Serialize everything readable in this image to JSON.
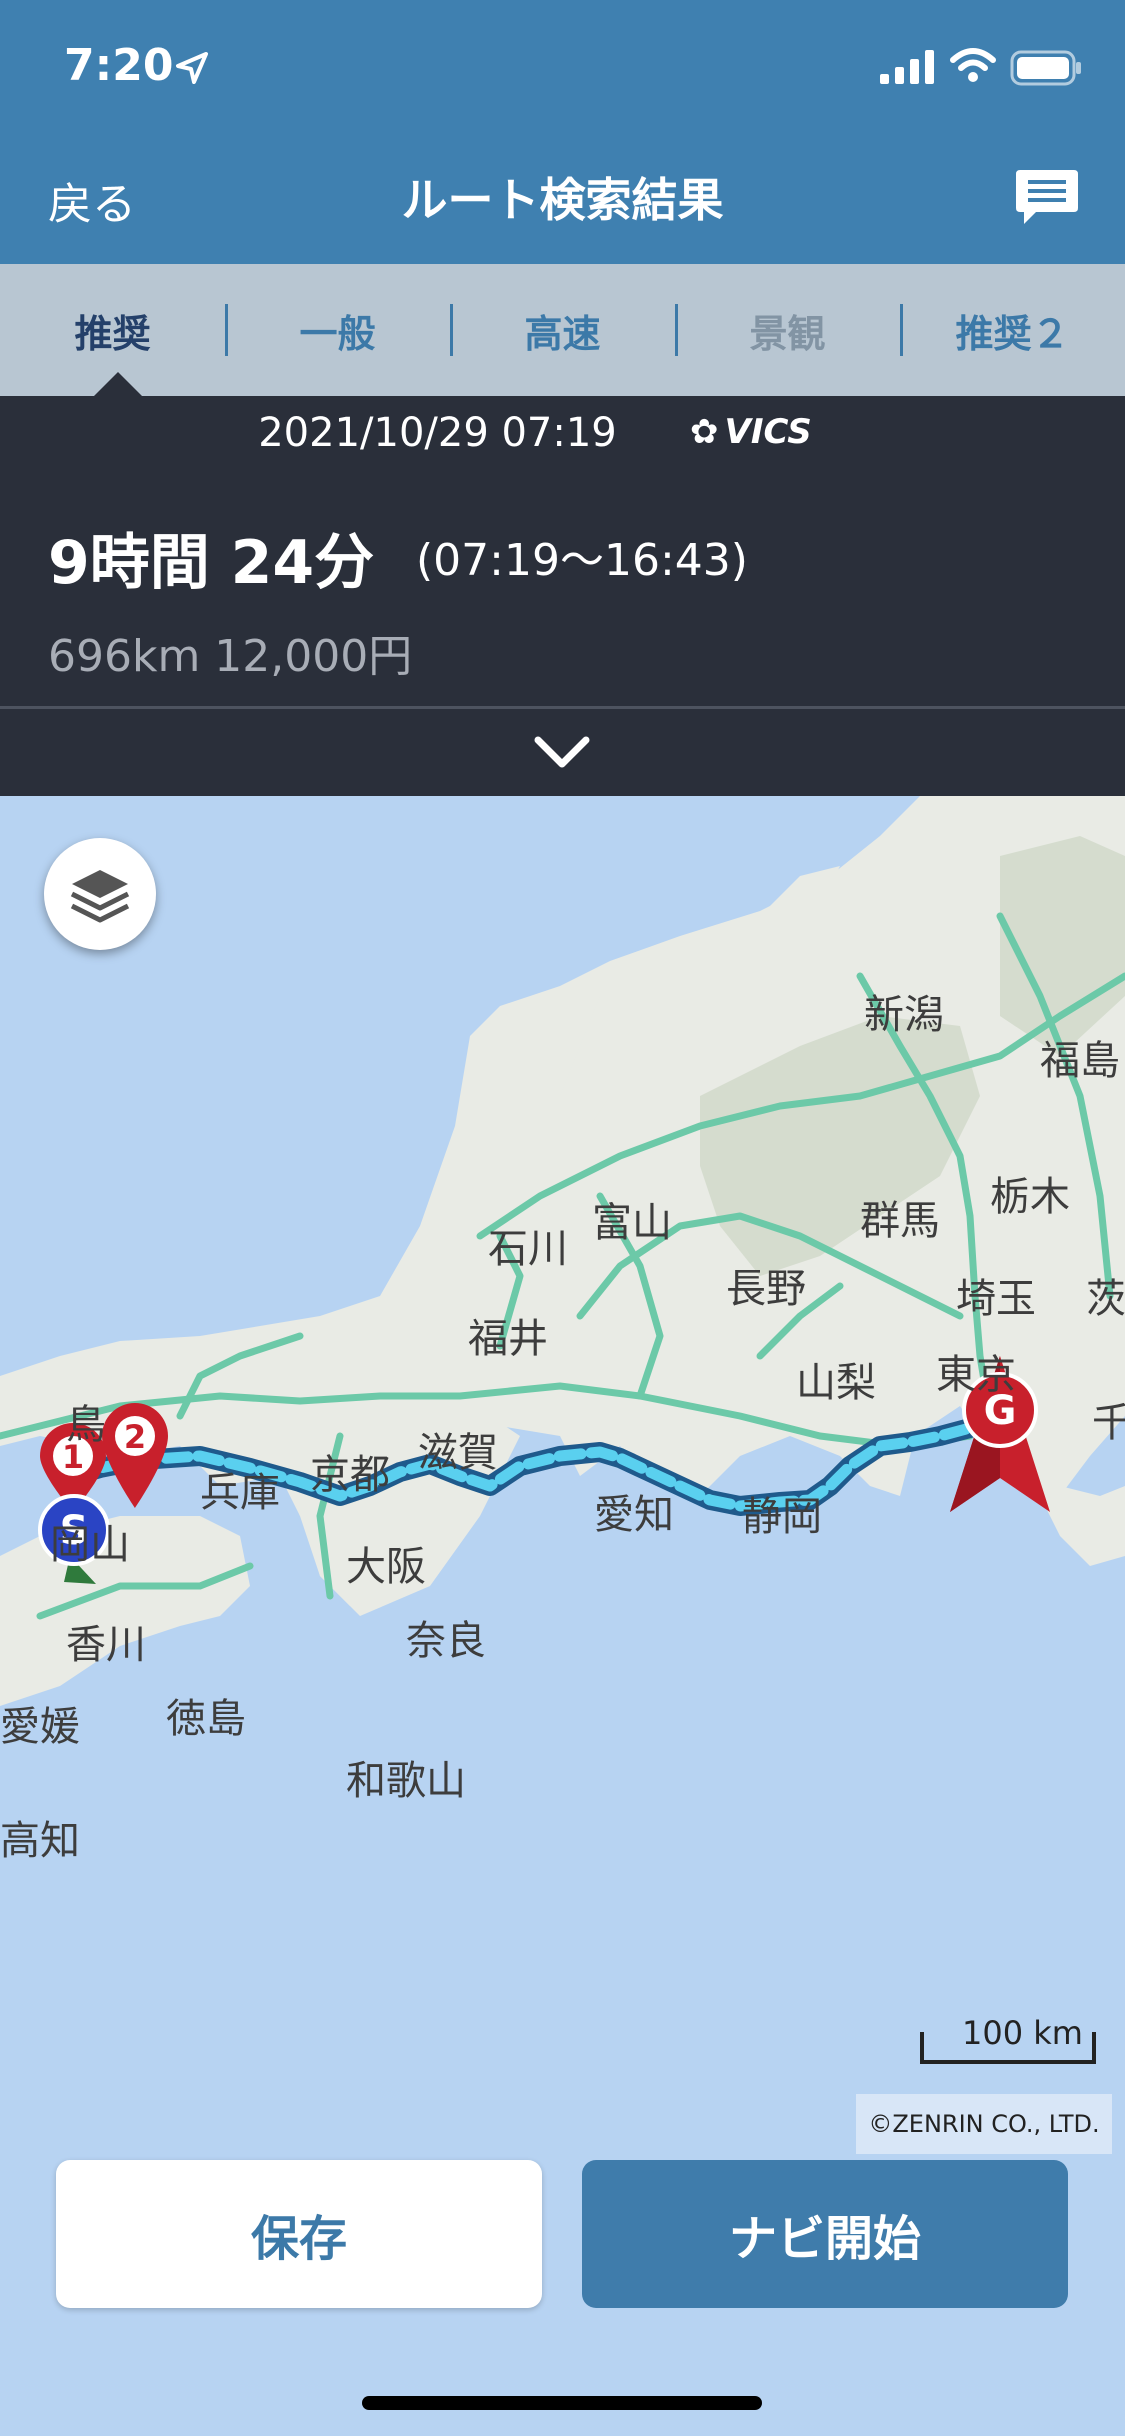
{
  "status": {
    "time": "7:20"
  },
  "nav": {
    "back": "戻る",
    "title": "ルート検索結果"
  },
  "tabs": [
    {
      "label": "推奨",
      "state": "active"
    },
    {
      "label": "一般",
      "state": "normal"
    },
    {
      "label": "高速",
      "state": "normal"
    },
    {
      "label": "景観",
      "state": "disabled"
    },
    {
      "label": "推奨２",
      "state": "normal"
    }
  ],
  "summary": {
    "datetime": "2021/10/29 07:19",
    "traffic_source": "VICS",
    "duration": "9時間 24分",
    "time_range": "(07:19～16:43)",
    "distance_fare": "696km  12,000円"
  },
  "map": {
    "places": [
      "新潟",
      "福島",
      "富山",
      "石川",
      "群馬",
      "栃木",
      "長野",
      "福井",
      "埼玉",
      "茨",
      "山梨",
      "東京",
      "千",
      "鳥",
      "兵庫",
      "京都",
      "滋賀",
      "愛知",
      "静岡",
      "岡山",
      "大阪",
      "香川",
      "奈良",
      "徳島",
      "愛媛",
      "和歌山",
      "高知"
    ],
    "markers": {
      "start": "S",
      "waypoint1": "1",
      "waypoint2": "2",
      "goal": "G"
    },
    "scale_label": "100 km",
    "copyright": "©ZENRIN CO., LTD."
  },
  "actions": {
    "save": "保存",
    "start_navi": "ナビ開始"
  },
  "colors": {
    "header": "#3f80b0",
    "tabs_bg": "#b8c6d2",
    "panel": "#2a2f3a",
    "sea": "#b7d3f2",
    "land": "#e9ebe5",
    "road": "#6cc9a8",
    "route_light": "#5ad0ef",
    "route_dark": "#1f5a8c",
    "marker_red": "#c8202c",
    "start_blue": "#2a44c4"
  }
}
